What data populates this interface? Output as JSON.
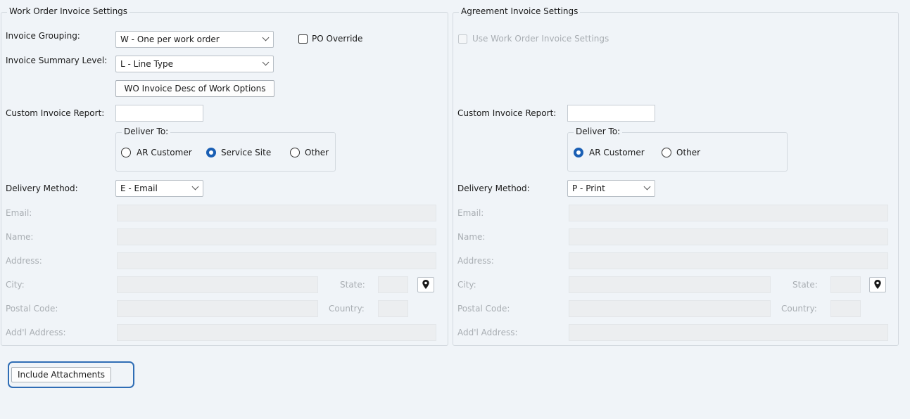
{
  "wo": {
    "title": "Work Order Invoice Settings",
    "invoice_grouping_label": "Invoice Grouping:",
    "invoice_grouping_value": "W - One per work order",
    "po_override_label": "PO Override",
    "summary_level_label": "Invoice Summary Level:",
    "summary_level_value": "L - Line Type",
    "desc_button": "WO Invoice Desc of Work Options",
    "custom_report_label": "Custom Invoice Report:",
    "deliver_to_title": "Deliver To:",
    "deliver_options": [
      "AR Customer",
      "Service Site",
      "Other"
    ],
    "deliver_selected": "Service Site",
    "delivery_method_label": "Delivery Method:",
    "delivery_method_value": "E - Email",
    "email_label": "Email:",
    "name_label": "Name:",
    "address_label": "Address:",
    "city_label": "City:",
    "state_label": "State:",
    "postal_label": "Postal Code:",
    "country_label": "Country:",
    "addl_label": "Add'l Address:"
  },
  "ag": {
    "title": "Agreement Invoice Settings",
    "use_wo_label": "Use Work Order Invoice Settings",
    "custom_report_label": "Custom Invoice Report:",
    "deliver_to_title": "Deliver To:",
    "deliver_options": [
      "AR Customer",
      "Other"
    ],
    "deliver_selected": "AR Customer",
    "delivery_method_label": "Delivery Method:",
    "delivery_method_value": "P - Print",
    "email_label": "Email:",
    "name_label": "Name:",
    "address_label": "Address:",
    "city_label": "City:",
    "state_label": "State:",
    "postal_label": "Postal Code:",
    "country_label": "Country:",
    "addl_label": "Add'l Address:"
  },
  "include_attachments_label": "Include Attachments",
  "colors": {
    "accent": "#1a5fb4",
    "highlight": "#2f6db5",
    "background": "#f0f4f8"
  },
  "icons": {
    "map_pin": "map-pin-icon"
  }
}
